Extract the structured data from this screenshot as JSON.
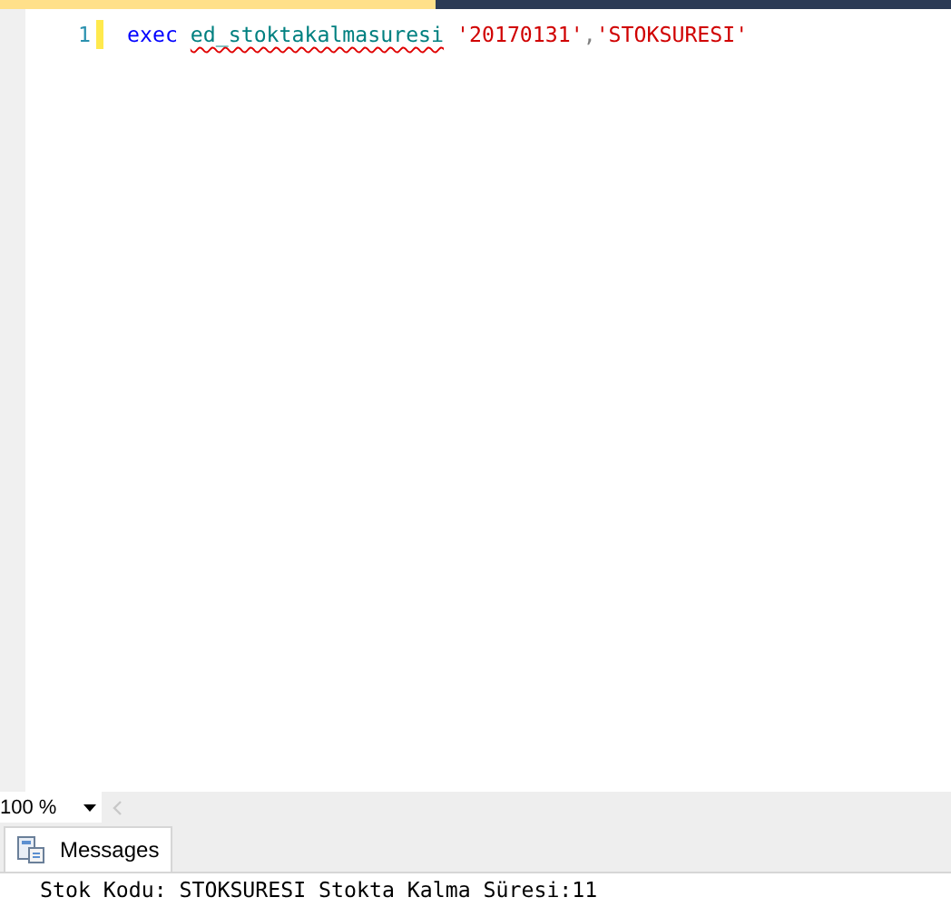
{
  "editor": {
    "lines": [
      {
        "number": "1",
        "modified": true,
        "tokens": [
          {
            "kind": "keyword",
            "text": "exec",
            "error": false
          },
          {
            "kind": "identifier",
            "text": "ed_stoktakalmasuresi",
            "error": true
          },
          {
            "kind": "string",
            "text": "'20170131'",
            "error": false
          },
          {
            "kind": "punct",
            "text": ",",
            "error": false
          },
          {
            "kind": "string",
            "text": "'STOKSURESI'",
            "error": false
          }
        ]
      }
    ]
  },
  "zoom": {
    "value": "100 %"
  },
  "results": {
    "tabs": [
      {
        "label": "Messages",
        "selected": true
      }
    ],
    "messages": [
      "Stok Kodu: STOKSURESI Stokta Kalma Süresi:11"
    ]
  }
}
